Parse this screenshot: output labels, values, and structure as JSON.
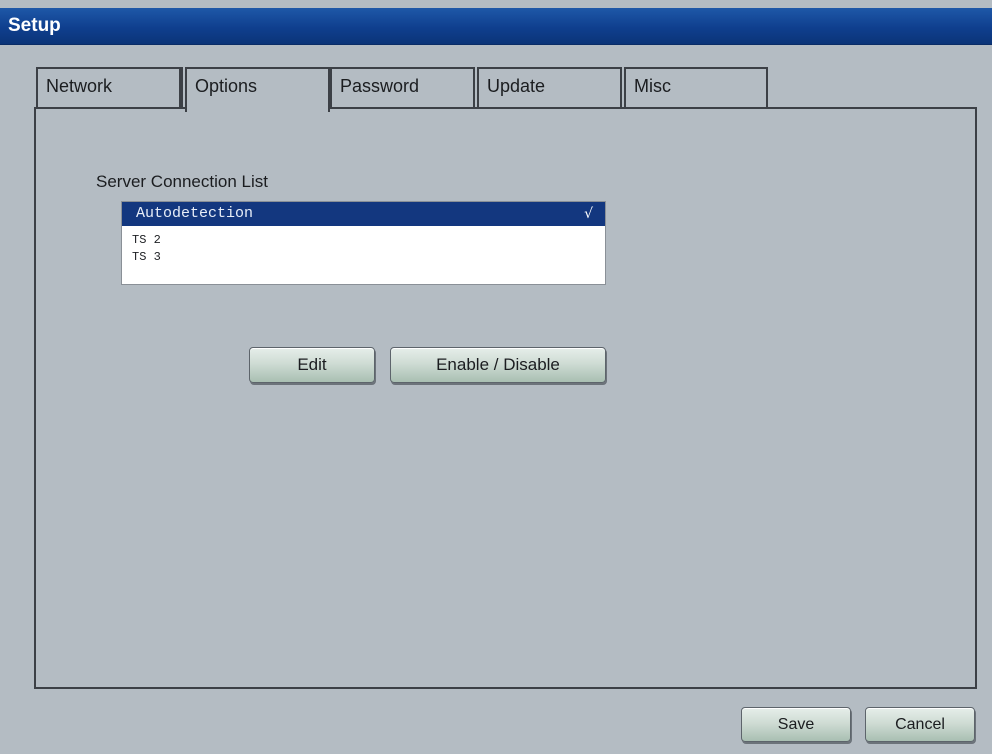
{
  "window": {
    "title": "Setup"
  },
  "tabs": [
    {
      "label": "Network"
    },
    {
      "label": "Options"
    },
    {
      "label": "Password"
    },
    {
      "label": "Update"
    },
    {
      "label": "Misc"
    }
  ],
  "active_tab": "Options",
  "server_list": {
    "label": "Server Connection List",
    "items": [
      {
        "name": "Autodetection",
        "selected": true,
        "enabled_mark": "√"
      },
      {
        "name": "TS 2",
        "selected": false
      },
      {
        "name": "TS 3",
        "selected": false
      }
    ]
  },
  "list_buttons": {
    "edit_label": "Edit",
    "enable_disable_label": "Enable / Disable"
  },
  "footer_buttons": {
    "save_label": "Save",
    "cancel_label": "Cancel"
  },
  "colors": {
    "titlebar": "#0f3f8e",
    "background": "#b4bcc3",
    "selection": "#13377f",
    "button_tint": "#cfdcd4"
  },
  "icons": {
    "checkmark": "check-icon"
  }
}
